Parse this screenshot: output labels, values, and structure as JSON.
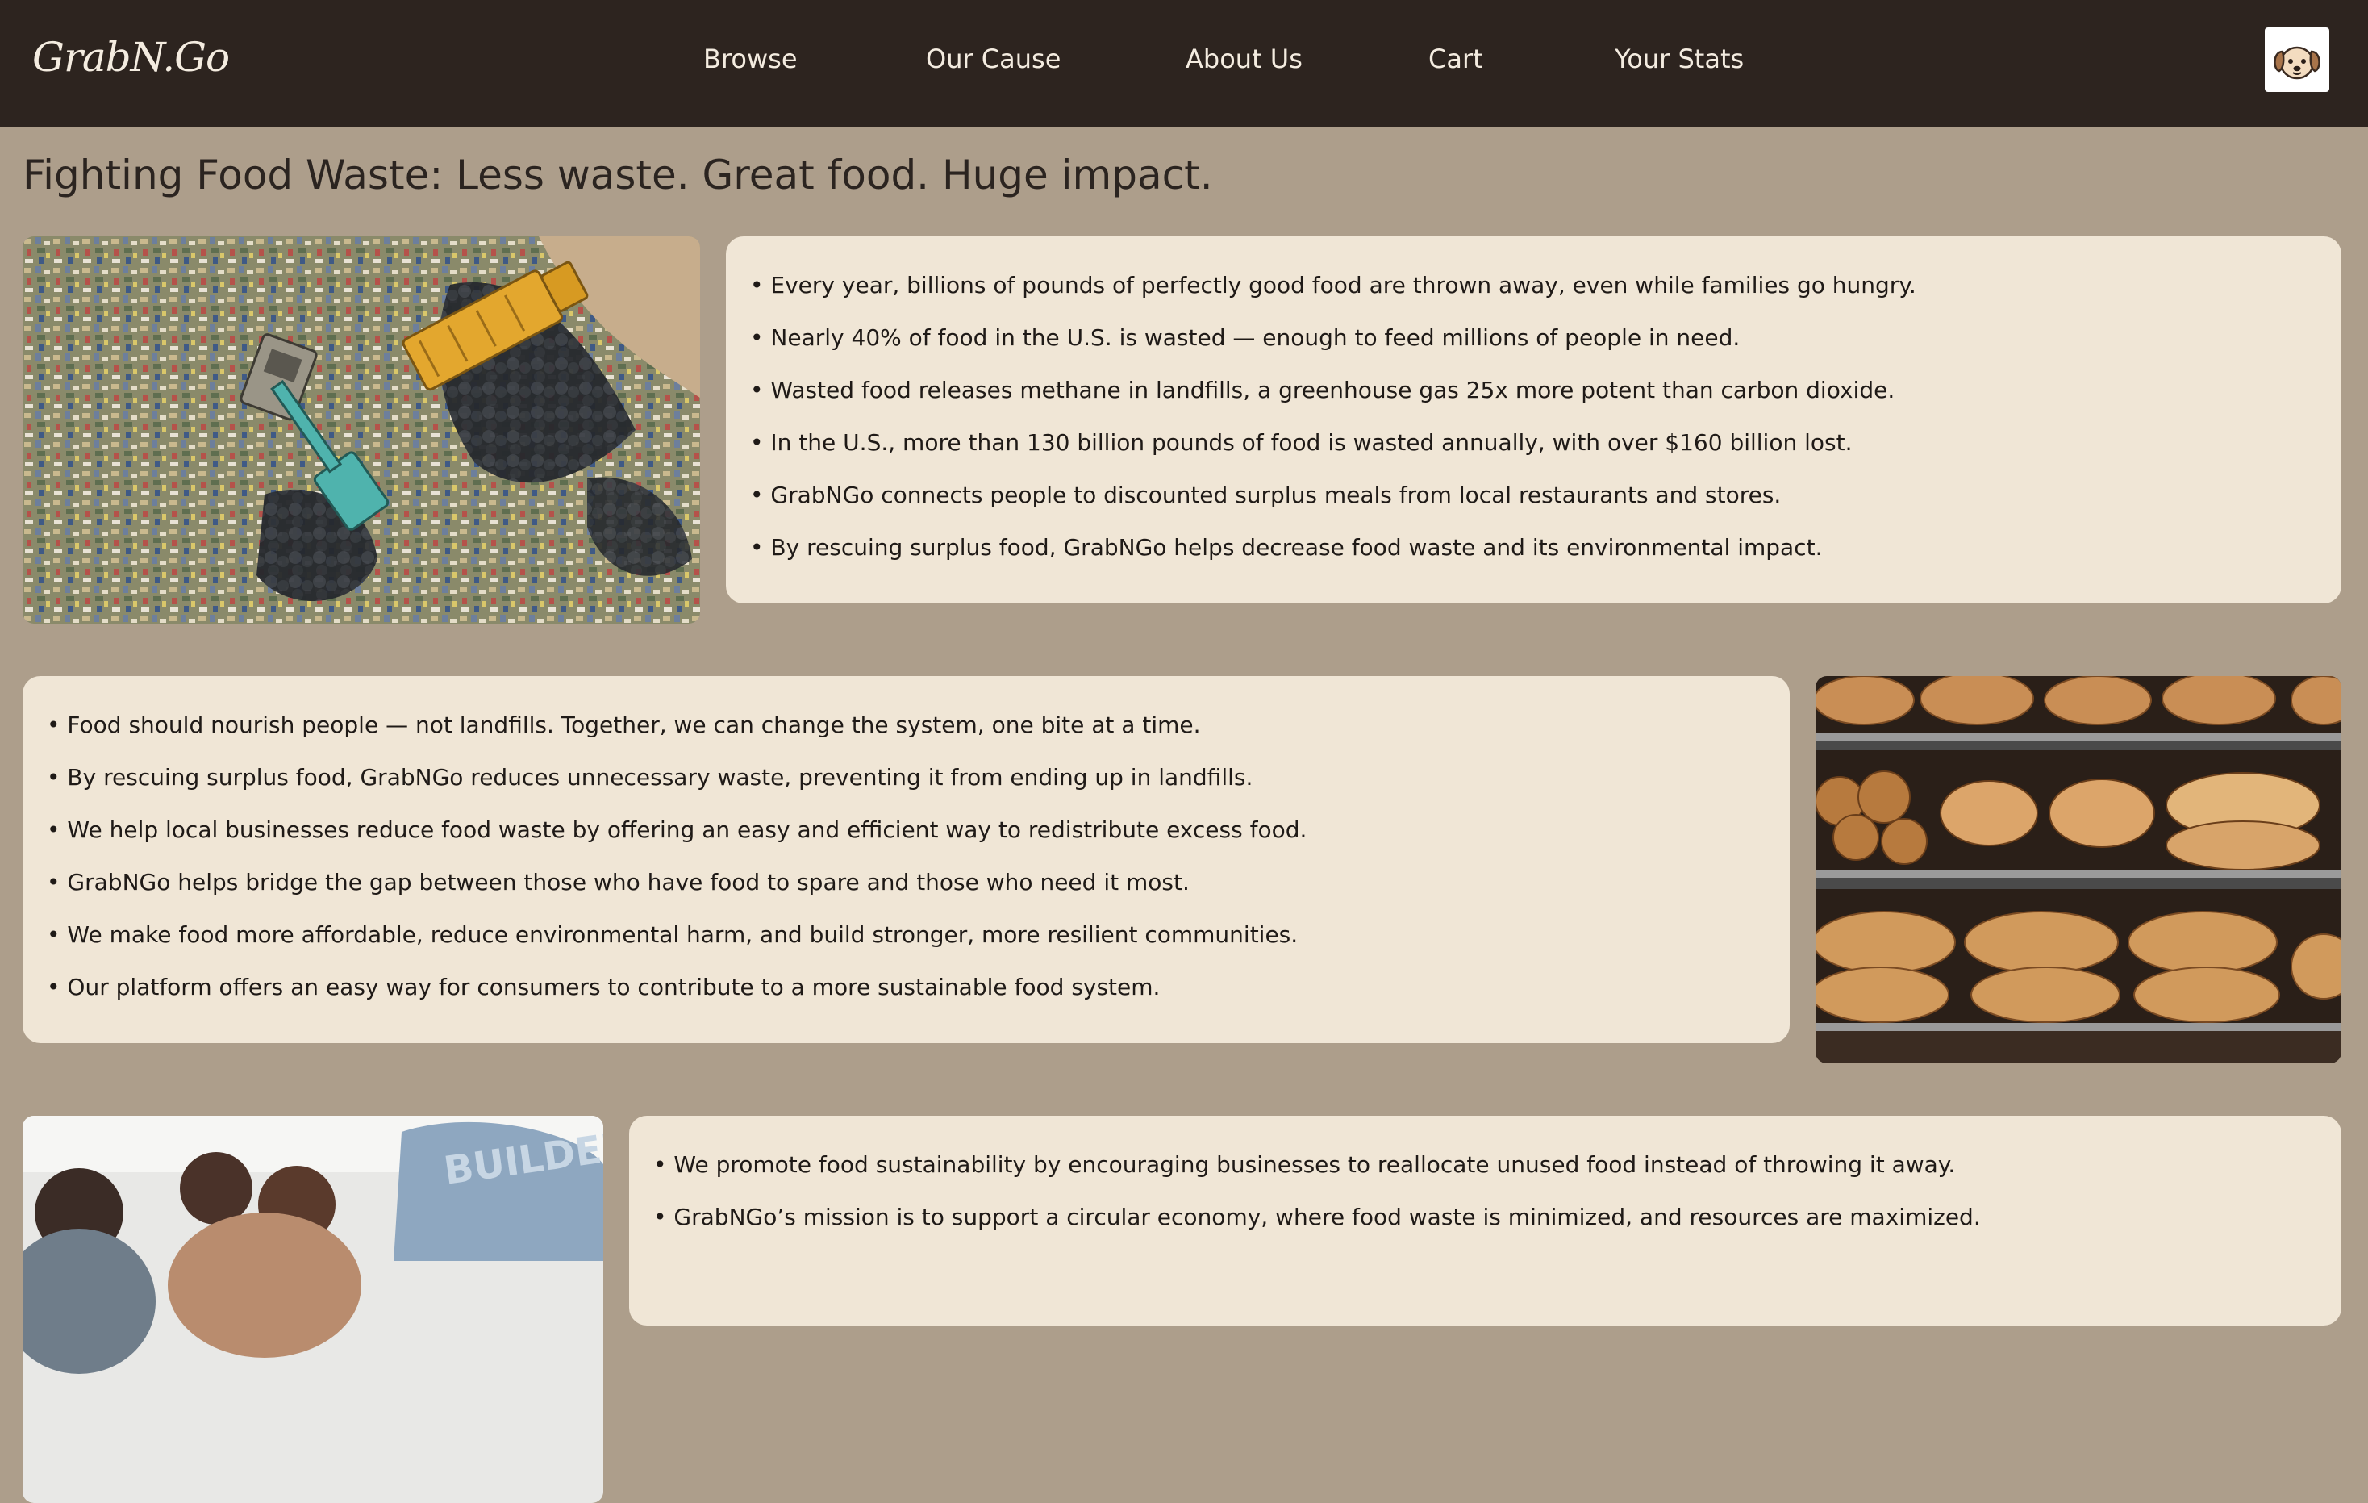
{
  "brand": {
    "logo_text": "GrabN.Go"
  },
  "nav": {
    "items": [
      {
        "label": "Browse"
      },
      {
        "label": "Our Cause"
      },
      {
        "label": "About Us"
      },
      {
        "label": "Cart"
      },
      {
        "label": "Your Stats"
      }
    ],
    "avatar_icon": "dog-face-icon"
  },
  "page": {
    "title": "Fighting Food Waste: Less waste. Great food. Huge impact."
  },
  "sections": [
    {
      "image_icon": "landfill-photo",
      "bullets": [
        "Every year, billions of pounds of perfectly good food are thrown away, even while families go hungry.",
        "Nearly 40% of food in the U.S. is wasted — enough to feed millions of people in need.",
        "Wasted food releases methane in landfills, a greenhouse gas 25x more potent than carbon dioxide.",
        "In the U.S., more than 130 billion pounds of food is wasted annually, with over $160 billion lost.",
        "GrabNGo connects people to discounted surplus meals from local restaurants and stores.",
        "By rescuing surplus food, GrabNGo helps decrease food waste and its environmental impact."
      ]
    },
    {
      "image_icon": "bakery-bread-shelves-photo",
      "bullets": [
        "Food should nourish people — not landfills. Together, we can change the system, one bite at a time.",
        "By rescuing surplus food, GrabNGo reduces unnecessary waste, preventing it from ending up in landfills.",
        "We help local businesses reduce food waste by offering an easy and efficient way to redistribute excess food.",
        "GrabNGo helps bridge the gap between those who have food to spare and those who need it most.",
        "We make food more affordable, reduce environmental harm, and build stronger, more resilient communities.",
        "Our platform offers an easy way for consumers to contribute to a more sustainable food system."
      ]
    },
    {
      "image_icon": "volunteers-photo",
      "bullets": [
        "We promote food sustainability by encouraging businesses to reallocate unused food instead of throwing it away.",
        "GrabNGo’s mission is to support a circular economy, where food waste is minimized, and resources are maximized."
      ]
    }
  ],
  "colors": {
    "navbar_bg": "#2d241f",
    "page_bg": "#ad9e8b",
    "card_bg": "#f0e6d6",
    "nav_text": "#f4ece0",
    "body_text": "#2b2420"
  }
}
